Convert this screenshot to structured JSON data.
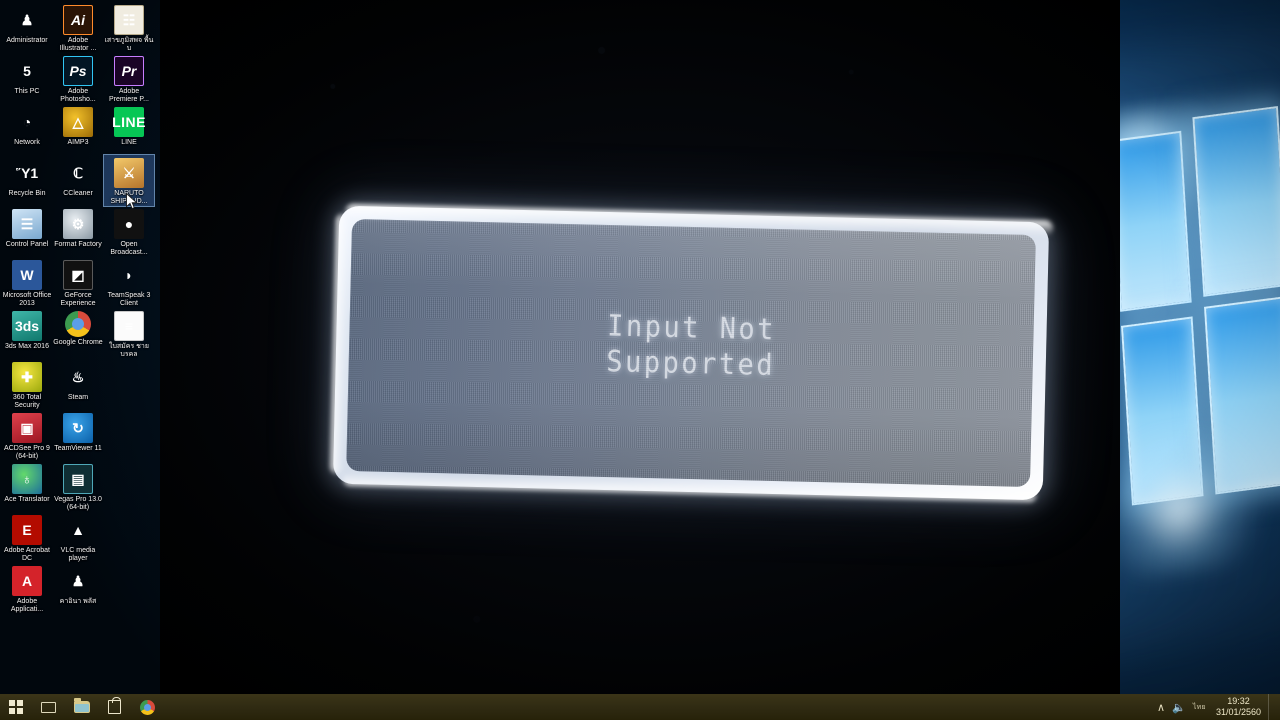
{
  "desktop": {
    "icons": [
      {
        "label": "Administrator",
        "icon": "administrator-icon",
        "art": "ic-admin",
        "glyph": "♟",
        "selected": false
      },
      {
        "label": "Adobe Illustrator ...",
        "icon": "adobe-illustrator-icon",
        "art": "ic-ai",
        "glyph": "Ai",
        "selected": false
      },
      {
        "label": "เสาขภูมิสพจ พื้นบ",
        "icon": "thai-document-icon",
        "art": "ic-book",
        "glyph": "☷",
        "selected": false
      },
      {
        "label": "This PC",
        "icon": "this-pc-icon",
        "art": "ic-pc",
        "glyph": "὚5",
        "selected": false
      },
      {
        "label": "Adobe Photosho...",
        "icon": "adobe-photoshop-icon",
        "art": "ic-ps",
        "glyph": "Ps",
        "selected": false
      },
      {
        "label": "Adobe Premiere P...",
        "icon": "adobe-premiere-icon",
        "art": "ic-pr",
        "glyph": "Pr",
        "selected": false
      },
      {
        "label": "Network",
        "icon": "network-icon",
        "art": "ic-net",
        "glyph": "◔",
        "selected": false
      },
      {
        "label": "AIMP3",
        "icon": "aimp3-icon",
        "art": "ic-aimp",
        "glyph": "△",
        "selected": false
      },
      {
        "label": "LINE",
        "icon": "line-icon",
        "art": "ic-line",
        "glyph": "LINE",
        "selected": false
      },
      {
        "label": "Recycle Bin",
        "icon": "recycle-bin-icon",
        "art": "ic-bin",
        "glyph": "Ὕ1",
        "selected": false
      },
      {
        "label": "CCleaner",
        "icon": "ccleaner-icon",
        "art": "ic-cc",
        "glyph": "ℂ",
        "selected": false
      },
      {
        "label": "NARUTO SHIPPUD...",
        "icon": "naruto-shippuden-icon",
        "art": "ic-naru",
        "glyph": "⚔",
        "selected": true
      },
      {
        "label": "Control Panel",
        "icon": "control-panel-icon",
        "art": "ic-cp",
        "glyph": "☰",
        "selected": false
      },
      {
        "label": "Format Factory",
        "icon": "format-factory-icon",
        "art": "ic-ff",
        "glyph": "⚙",
        "selected": false
      },
      {
        "label": "Open Broadcast...",
        "icon": "open-broadcaster-icon",
        "art": "ic-obs",
        "glyph": "●",
        "selected": false
      },
      {
        "label": "Microsoft Office 2013",
        "icon": "microsoft-word-icon",
        "art": "ic-word",
        "glyph": "W",
        "selected": false
      },
      {
        "label": "GeForce Experience",
        "icon": "geforce-experience-icon",
        "art": "ic-gf",
        "glyph": "◩",
        "selected": false
      },
      {
        "label": "TeamSpeak 3 Client",
        "icon": "teamspeak-icon",
        "art": "ic-ts",
        "glyph": "◗",
        "selected": false
      },
      {
        "label": "3ds Max 2016",
        "icon": "3ds-max-icon",
        "art": "ic-3ds",
        "glyph": "3ds",
        "selected": false
      },
      {
        "label": "Google Chrome",
        "icon": "google-chrome-icon",
        "art": "ic-chrome",
        "glyph": "",
        "selected": false
      },
      {
        "label": "ใบสมัคร ชาย บรคล",
        "icon": "thai-text-document-icon",
        "art": "ic-doc",
        "glyph": "≡",
        "selected": false
      },
      {
        "label": "360 Total Security",
        "icon": "360-total-security-icon",
        "art": "ic-360",
        "glyph": "✚",
        "selected": false
      },
      {
        "label": "Steam",
        "icon": "steam-icon",
        "art": "ic-steam",
        "glyph": "♨",
        "selected": false
      },
      {
        "label": "",
        "icon": "empty-slot",
        "art": "",
        "glyph": "",
        "selected": false
      },
      {
        "label": "ACDSee Pro 9 (64-bit)",
        "icon": "acdsee-pro-icon",
        "art": "ic-acd",
        "glyph": "▣",
        "selected": false
      },
      {
        "label": "TeamViewer 11",
        "icon": "teamviewer-icon",
        "art": "ic-tv",
        "glyph": "↻",
        "selected": false
      },
      {
        "label": "",
        "icon": "empty-slot",
        "art": "",
        "glyph": "",
        "selected": false
      },
      {
        "label": "Ace Translator",
        "icon": "ace-translator-icon",
        "art": "ic-ace",
        "glyph": "♁",
        "selected": false
      },
      {
        "label": "Vegas Pro 13.0 (64-bit)",
        "icon": "vegas-pro-icon",
        "art": "ic-vp",
        "glyph": "▤",
        "selected": false
      },
      {
        "label": "",
        "icon": "empty-slot",
        "art": "",
        "glyph": "",
        "selected": false
      },
      {
        "label": "Adobe Acrobat DC",
        "icon": "adobe-acrobat-icon",
        "art": "ic-acro",
        "glyph": "὜E",
        "selected": false
      },
      {
        "label": "VLC media player",
        "icon": "vlc-media-player-icon",
        "art": "ic-vlc",
        "glyph": "▲",
        "selected": false
      },
      {
        "label": "",
        "icon": "empty-slot",
        "art": "",
        "glyph": "",
        "selected": false
      },
      {
        "label": "Adobe Applicati...",
        "icon": "adobe-application-icon",
        "art": "ic-adac",
        "glyph": "A",
        "selected": false
      },
      {
        "label": "คาอินา พลัส",
        "icon": "thai-app-icon",
        "art": "ic-thai",
        "glyph": "♟",
        "selected": false
      },
      {
        "label": "",
        "icon": "empty-slot",
        "art": "",
        "glyph": "",
        "selected": false
      }
    ]
  },
  "osd": {
    "message": "Input Not\nSupported",
    "line1": "Input Not",
    "line2": "Supported",
    "panel_color": "#7d889a",
    "border_color": "#eef3fb",
    "text_color": "#d8dde6"
  },
  "taskbar": {
    "start_label": "Start",
    "buttons": [
      {
        "name": "start-button",
        "label": "Start"
      },
      {
        "name": "task-view-button",
        "label": "Task View"
      },
      {
        "name": "file-explorer-button",
        "label": "File Explorer"
      },
      {
        "name": "microsoft-store-button",
        "label": "Microsoft Store"
      },
      {
        "name": "google-chrome-button",
        "label": "Google Chrome"
      }
    ],
    "tray": {
      "show_hidden_label": "∧",
      "volume_label": "ὐA",
      "language": "ไทย",
      "time": "19:32",
      "date": "31/01/2560"
    }
  },
  "colors": {
    "wallpaper_blue": "#0a3866",
    "black_overlay": "#030508",
    "taskbar": "#2f2a12",
    "osd_text": "#d8dde6"
  }
}
